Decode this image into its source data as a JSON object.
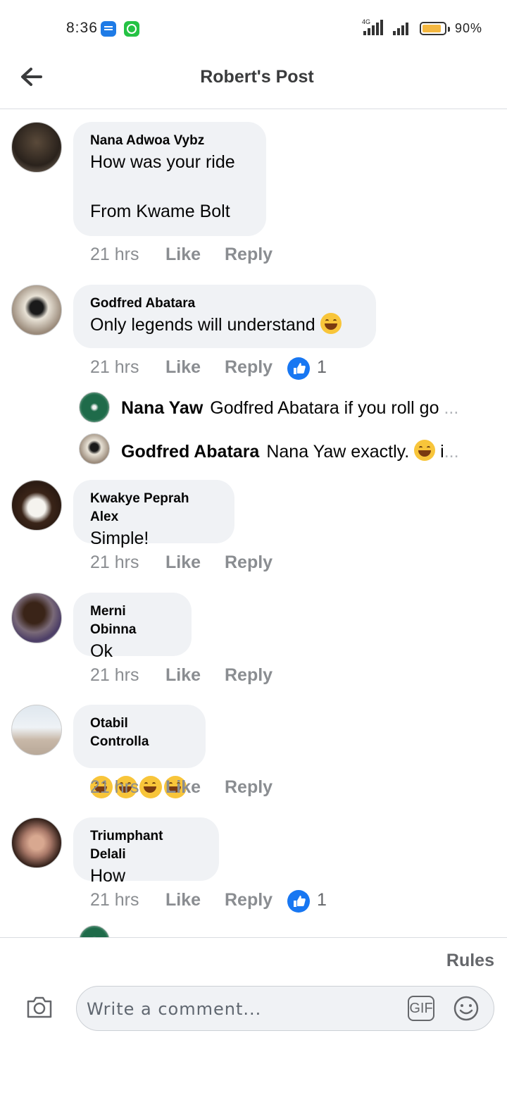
{
  "status_bar": {
    "time": "8:36",
    "network": "4G",
    "battery": "90%",
    "battery_level": 0.9
  },
  "header": {
    "title": "Robert's Post"
  },
  "comments": [
    {
      "author": "Nana Adwoa Vybz",
      "text": "How was your ride\n\nFrom Kwame Bolt",
      "time": "21 hrs",
      "like": "Like",
      "reply": "Reply"
    },
    {
      "author": "Godfred Abatara",
      "text": "Only legends will understand",
      "time": "21 hrs",
      "like": "Like",
      "reply": "Reply",
      "reactions": "1",
      "replies": [
        {
          "author": "Nana Yaw",
          "text": "Godfred Abatara if you roll go",
          "ellipsis": "..."
        },
        {
          "author": "Godfred Abatara",
          "text": "Nana Yaw exactly.",
          "tail": "i",
          "ellipsis": "..."
        }
      ]
    },
    {
      "author": "Kwakye Peprah Alex",
      "text": "Simple!",
      "time": "21 hrs",
      "like": "Like",
      "reply": "Reply"
    },
    {
      "author": "Merni Obinna",
      "text": "Ok",
      "time": "21 hrs",
      "like": "Like",
      "reply": "Reply"
    },
    {
      "author": "Otabil Controlla",
      "text": "",
      "time": "21 hrs",
      "like": "Like",
      "reply": "Reply"
    },
    {
      "author": "Triumphant Delali",
      "text": "How",
      "time": "21 hrs",
      "like": "Like",
      "reply": "Reply",
      "reactions": "1"
    }
  ],
  "composer": {
    "rules": "Rules",
    "placeholder": "Write a comment...",
    "gif": "GIF"
  }
}
